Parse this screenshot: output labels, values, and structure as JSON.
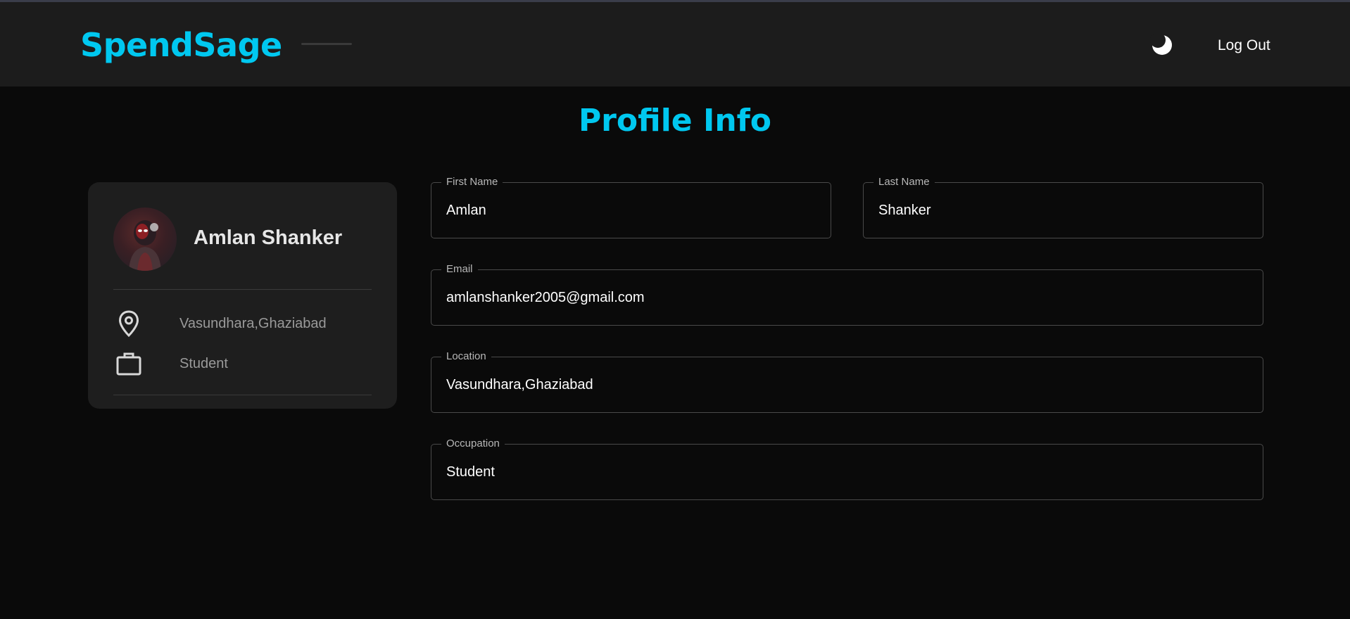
{
  "header": {
    "brand": "SpendSage",
    "logout_label": "Log Out",
    "theme_icon": "moon-icon"
  },
  "page_title": "Profile Info",
  "profile_card": {
    "name": "Amlan Shanker",
    "location": "Vasundhara,Ghaziabad",
    "occupation": "Student",
    "icons": {
      "location": "location-pin-icon",
      "occupation": "briefcase-icon"
    }
  },
  "form": {
    "first_name": {
      "label": "First Name",
      "value": "Amlan"
    },
    "last_name": {
      "label": "Last Name",
      "value": "Shanker"
    },
    "email": {
      "label": "Email",
      "value": "amlanshanker2005@gmail.com"
    },
    "location": {
      "label": "Location",
      "value": "Vasundhara,Ghaziabad"
    },
    "occupation": {
      "label": "Occupation",
      "value": "Student"
    }
  },
  "colors": {
    "accent": "#00c8f0",
    "background": "#0a0a0a",
    "header_bg": "#1c1c1c",
    "card_bg": "#1e1e1e"
  }
}
